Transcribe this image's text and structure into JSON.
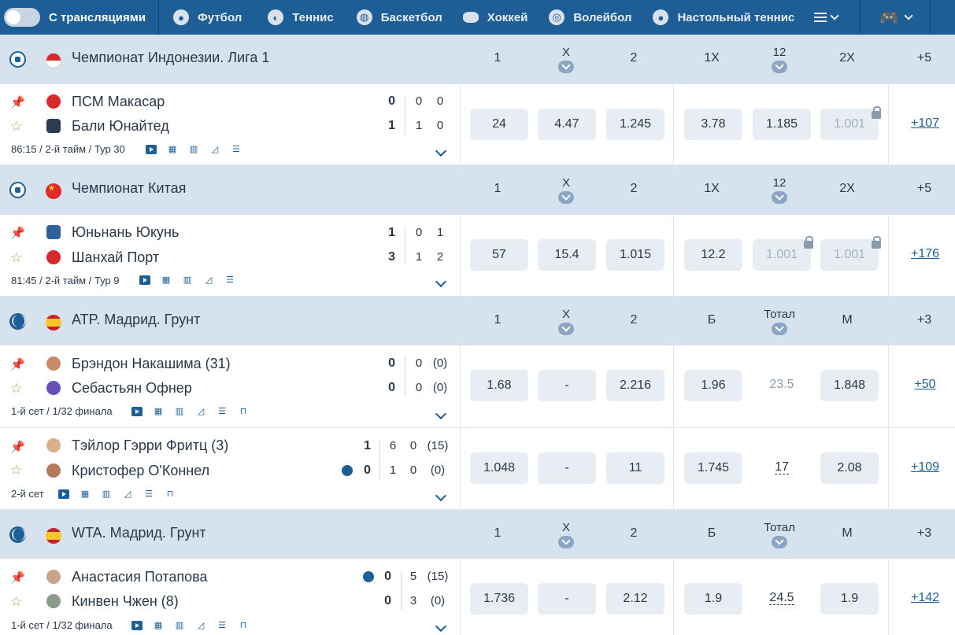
{
  "nav": {
    "toggle_label": "С трансляциями",
    "items": [
      {
        "label": "Футбол",
        "icon": "football-icon"
      },
      {
        "label": "Теннис",
        "icon": "tennis-icon"
      },
      {
        "label": "Баскетбол",
        "icon": "basketball-icon"
      },
      {
        "label": "Хоккей",
        "icon": "hockey-icon"
      },
      {
        "label": "Волейбол",
        "icon": "volleyball-icon"
      },
      {
        "label": "Настольный теннис",
        "icon": "table-tennis-icon"
      }
    ]
  },
  "leagues": [
    {
      "name": "Чемпионат Индонезии. Лига 1",
      "cols": [
        "1",
        "X",
        "2",
        "1X",
        "12",
        "2X"
      ],
      "more": "+5"
    },
    {
      "name": "Чемпионат Китая",
      "cols": [
        "1",
        "X",
        "2",
        "1X",
        "12",
        "2X"
      ],
      "more": "+5"
    },
    {
      "name": "ATP. Мадрид. Грунт",
      "cols": [
        "1",
        "X",
        "2",
        "Б",
        "Тотал",
        "М"
      ],
      "more": "+3"
    },
    {
      "name": "WTA. Мадрид. Грунт",
      "cols": [
        "1",
        "X",
        "2",
        "Б",
        "Тотал",
        "М"
      ],
      "more": "+3"
    }
  ],
  "events": [
    {
      "team1": "ПСМ Макасар",
      "team2": "Бали Юнайтед",
      "s1": "0",
      "s2": "1",
      "p1": [
        "0",
        "0"
      ],
      "p2": [
        "1",
        "0"
      ],
      "meta": "86:15 / 2-й тайм / Тур 30",
      "odds": [
        "24",
        "4.47",
        "1.245",
        "3.78",
        "1.185",
        "1.001"
      ],
      "more": "+107"
    },
    {
      "team1": "Юньнань Юкунь",
      "team2": "Шанхай Порт",
      "s1": "1",
      "s2": "3",
      "p1": [
        "0",
        "1"
      ],
      "p2": [
        "1",
        "2"
      ],
      "meta": "81:45 / 2-й тайм / Тур 9",
      "odds": [
        "57",
        "15.4",
        "1.015",
        "12.2",
        "1.001",
        "1.001"
      ],
      "more": "+176"
    },
    {
      "team1": "Брэндон Накашима (31)",
      "team2": "Себастьян Офнер",
      "s1": "0",
      "s2": "0",
      "p1": [
        "0",
        "(0)"
      ],
      "p2": [
        "0",
        "(0)"
      ],
      "meta": "1-й сет / 1/32 финала",
      "odds": [
        "1.68",
        "-",
        "2.216",
        "1.96",
        "23.5",
        "1.848"
      ],
      "more": "+50"
    },
    {
      "team1": "Тэйлор Гэрри Фритц (3)",
      "team2": "Кристофер О'Коннел",
      "s1": "1",
      "s2": "0",
      "p1": [
        "6",
        "0",
        "(15)"
      ],
      "p2": [
        "1",
        "0",
        "(0)"
      ],
      "meta": "2-й сет",
      "odds": [
        "1.048",
        "-",
        "11",
        "1.745",
        "17",
        "2.08"
      ],
      "more": "+109"
    },
    {
      "team1": "Анастасия Потапова",
      "team2": "Кинвен Чжен (8)",
      "s1": "0",
      "s2": "0",
      "p1": [
        "5",
        "(15)"
      ],
      "p2": [
        "3",
        "(0)"
      ],
      "meta": "1-й сет / 1/32 финала",
      "odds": [
        "1.736",
        "-",
        "2.12",
        "1.9",
        "24.5",
        "1.9"
      ],
      "more": "+142"
    }
  ],
  "colors": {
    "nav_bg": "#1d5e96",
    "league_bg": "#d7e2ef",
    "odd_bg": "#e8edf3",
    "star": "#8bb84a"
  }
}
